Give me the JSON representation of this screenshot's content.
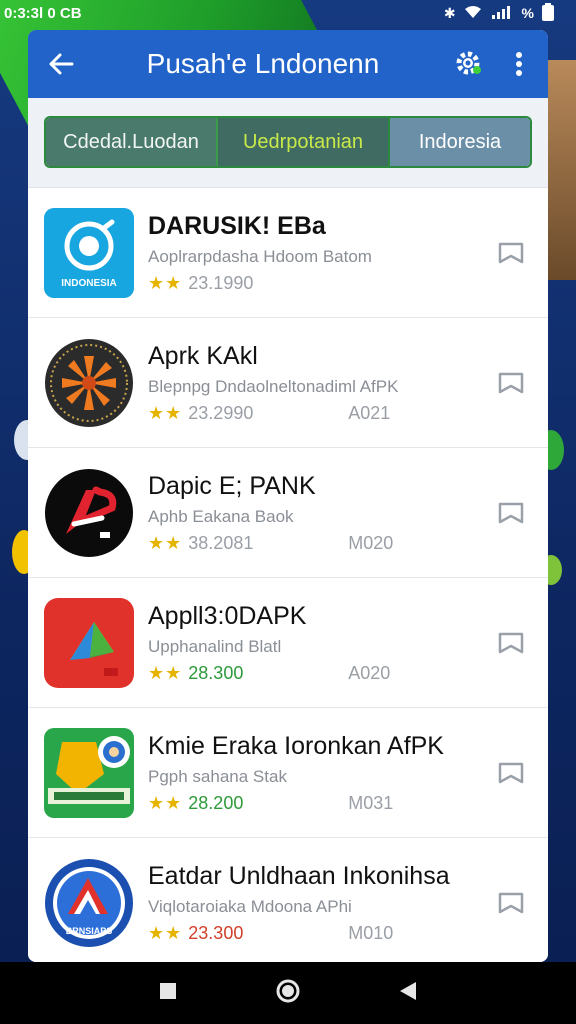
{
  "status": {
    "time": "0:3:3l 0 CB",
    "battery": "%"
  },
  "appbar": {
    "title": "Pusah'e Lndonenn"
  },
  "tabs": [
    {
      "label": "Cdedal.Luodan"
    },
    {
      "label": "Uedrpotanian"
    },
    {
      "label": "Indoresia"
    }
  ],
  "apps": [
    {
      "name": "DARUSIK! EBa",
      "desc": "Aoplrarpdasha Hdoom Batom",
      "rating": "23.1990",
      "code": "",
      "icon_text": "INDONESIA",
      "rating_color": "gray"
    },
    {
      "name": "Aprk KAkl",
      "desc": "Blepnpg Dndaolneltonadiml AfPK",
      "rating": "23.2990",
      "code": "A021",
      "rating_color": "gray"
    },
    {
      "name": "Dapic E; PANK",
      "desc": "Aphb Eakana Baok",
      "rating": "38.2081",
      "code": "M020",
      "rating_color": "gray"
    },
    {
      "name": "Appll3:0DAPK",
      "desc": "Upphanalind Blatl",
      "rating": "28.300",
      "code": "A020",
      "rating_color": "green"
    },
    {
      "name": "Kmie Eraka Ioronkan AfPK",
      "desc": "Pgph sahana Stak",
      "rating": "28.200",
      "code": "M031",
      "rating_color": "green"
    },
    {
      "name": "Eatdar Unldhaan Inkonihsa",
      "desc": "Viqlotaroiaka Mdoona APhi",
      "rating": "23.300",
      "code": "M010",
      "rating_color": "red",
      "icon_text": "BRNSIAPS"
    }
  ],
  "stars": "★★",
  "colors": {
    "appbar": "#2163c8",
    "accent_green": "#2e9a3a",
    "star": "#e5b400"
  },
  "icons": {
    "back": "arrow-left-icon",
    "settings": "gear-icon",
    "more": "more-vert-icon",
    "bookmark": "bookmark-icon",
    "nav_recent": "square-icon",
    "nav_home": "circle-icon",
    "nav_back": "triangle-icon"
  }
}
